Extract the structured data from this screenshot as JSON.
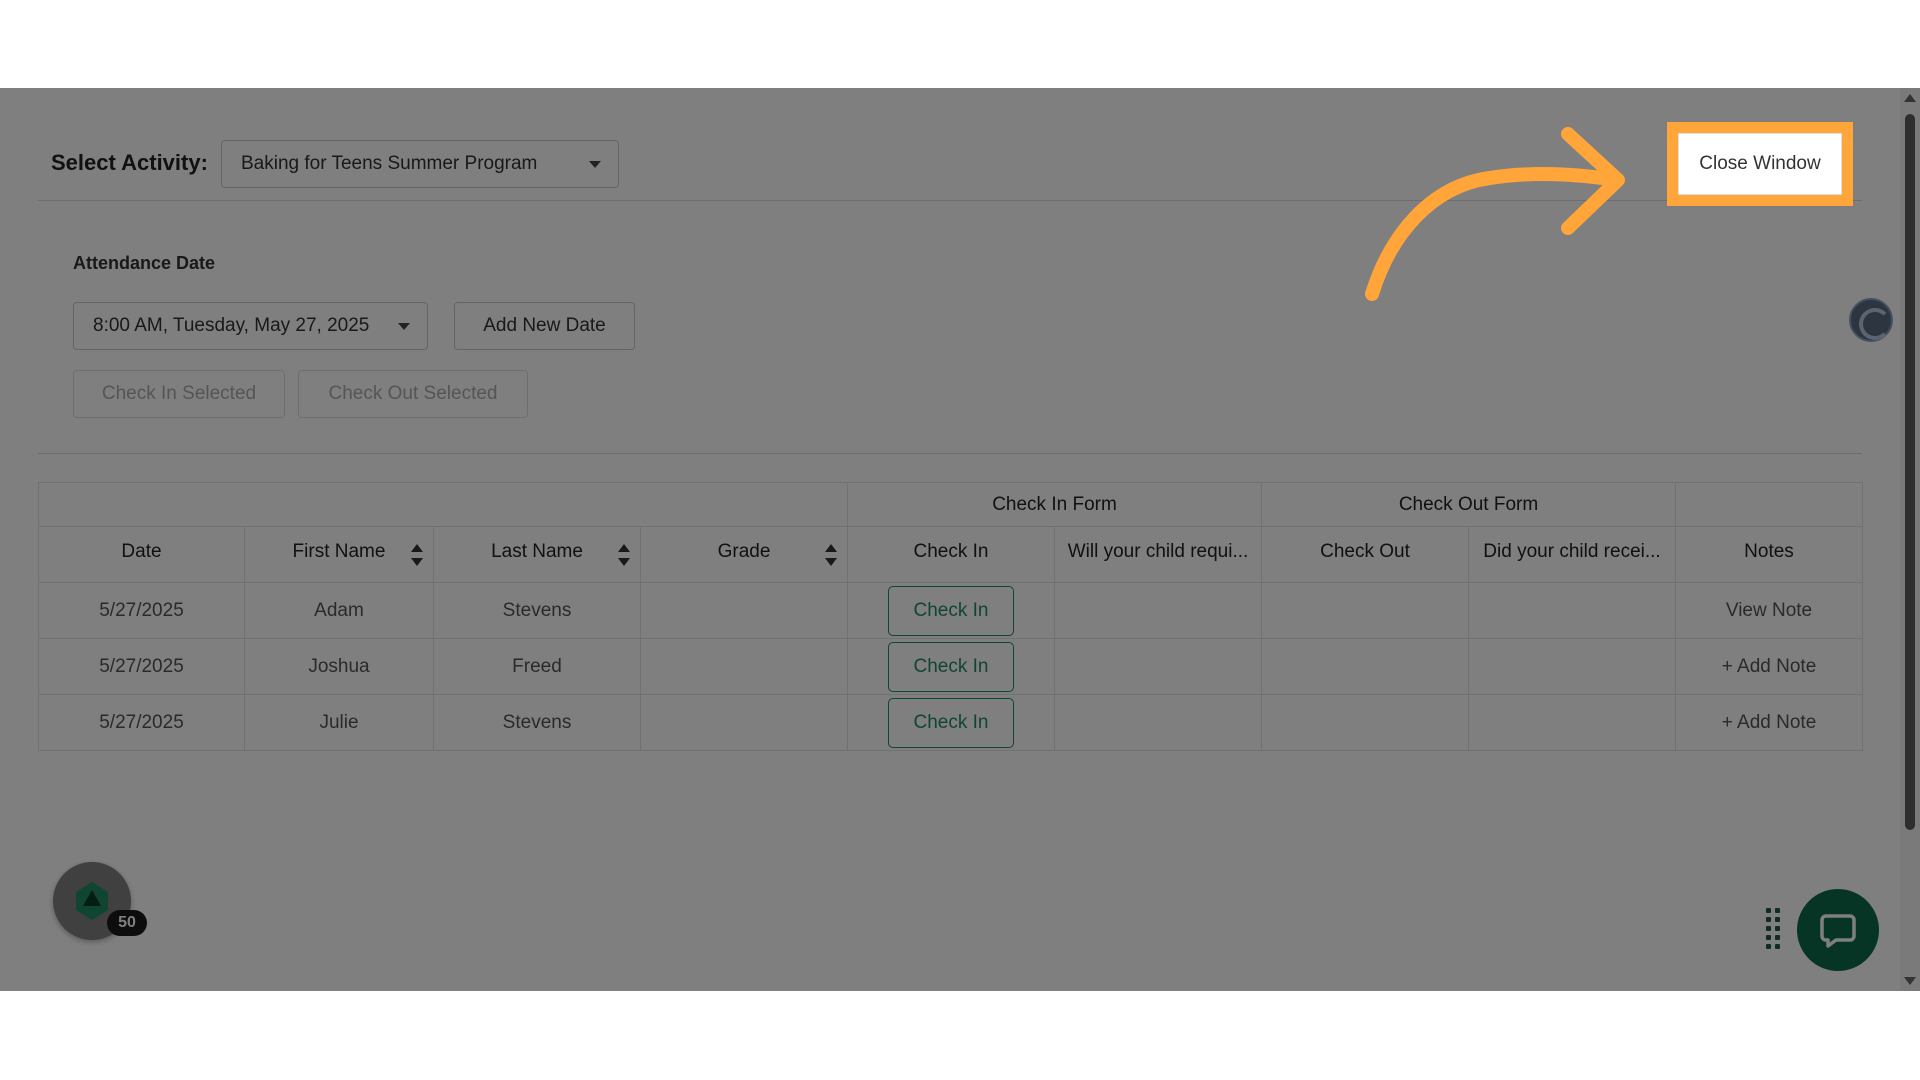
{
  "activity": {
    "label": "Select Activity:",
    "selected": "Baking for Teens Summer Program"
  },
  "attendance": {
    "label": "Attendance Date",
    "selected_date": "8:00 AM, Tuesday, May 27, 2025",
    "add_new_date": "Add New Date",
    "check_in_selected": "Check In Selected",
    "check_out_selected": "Check Out Selected"
  },
  "close_window": "Close Window",
  "table": {
    "group_headers": {
      "check_in_form": "Check In Form",
      "check_out_form": "Check Out Form"
    },
    "columns": [
      "Date",
      "First Name",
      "Last Name",
      "Grade",
      "Check In",
      "Will your child requi...",
      "Check Out",
      "Did your child recei...",
      "Notes"
    ],
    "rows": [
      {
        "date": "5/27/2025",
        "first_name": "Adam",
        "last_name": "Stevens",
        "grade": "",
        "check_in": "Check In",
        "q1": "",
        "check_out": "",
        "q2": "",
        "notes": "View Note"
      },
      {
        "date": "5/27/2025",
        "first_name": "Joshua",
        "last_name": "Freed",
        "grade": "",
        "check_in": "Check In",
        "q1": "",
        "check_out": "",
        "q2": "",
        "notes": "+ Add Note"
      },
      {
        "date": "5/27/2025",
        "first_name": "Julie",
        "last_name": "Stevens",
        "grade": "",
        "check_in": "Check In",
        "q1": "",
        "check_out": "",
        "q2": "",
        "notes": "+ Add Note"
      }
    ]
  },
  "badge": {
    "count": "50"
  },
  "colors": {
    "accent_green": "#1e8a63",
    "highlight_orange": "#ffa53a",
    "chat_green": "#0d6b4a"
  },
  "icons": [
    "caret-down-icon",
    "sort-icon",
    "refresh-icon",
    "app-logo-icon",
    "grip-icon",
    "chat-icon",
    "arrow-annotation-icon"
  ]
}
